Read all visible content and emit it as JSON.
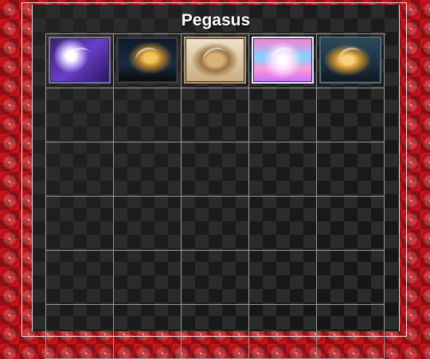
{
  "page": {
    "title": "Pegasus"
  },
  "board": {
    "columns": 5,
    "rows": 6,
    "images": [
      {
        "name": "pegasus-image-1",
        "theme": "purple-night"
      },
      {
        "name": "pegasus-image-2",
        "theme": "gold-dark"
      },
      {
        "name": "pegasus-image-3",
        "theme": "sepia"
      },
      {
        "name": "pegasus-image-4",
        "theme": "rainbow-pastel"
      },
      {
        "name": "pegasus-image-5",
        "theme": "gold-teal"
      }
    ]
  },
  "colors": {
    "background": "#c8141a",
    "panel": "#1a1a1a",
    "grid_lines": "#9a9a9a",
    "title": "#ffffff"
  }
}
